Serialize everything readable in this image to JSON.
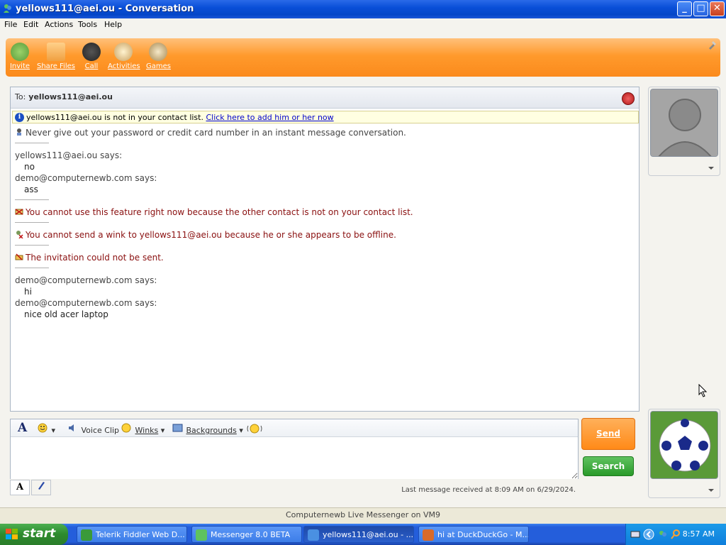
{
  "window": {
    "title": "yellows111@aei.ou - Conversation",
    "min_label": "_",
    "max_label": "□",
    "close_label": "✕"
  },
  "menu": [
    "File",
    "Edit",
    "Actions",
    "Tools",
    "Help"
  ],
  "toolbar": {
    "items": [
      {
        "label": "Invite",
        "icon": "invite-icon"
      },
      {
        "label": "Share Files",
        "icon": "folder-icon"
      },
      {
        "label": "Call",
        "icon": "phone-icon"
      },
      {
        "label": "Activities",
        "icon": "activities-icon"
      },
      {
        "label": "Games",
        "icon": "games-icon"
      }
    ]
  },
  "conversation": {
    "to_label": "To:",
    "to_address": "yellows111@aei.ou",
    "info_text": "yellows111@aei.ou is not in your contact list.",
    "info_link": "Click here to add him or her now",
    "messages": [
      {
        "type": "system",
        "text": "Never give out your password or credit card number in an instant message conversation."
      },
      {
        "type": "header",
        "text": "yellows111@aei.ou says:"
      },
      {
        "type": "body",
        "text": "no"
      },
      {
        "type": "header",
        "text": "demo@computernewb.com says:"
      },
      {
        "type": "body",
        "text": "ass"
      },
      {
        "type": "warn",
        "text": "You cannot use this feature right now because the other contact is not on your contact list."
      },
      {
        "type": "warn",
        "text": "You cannot send a wink to yellows111@aei.ou because he or she appears to be offline."
      },
      {
        "type": "warn",
        "text": "The invitation could not be sent."
      },
      {
        "type": "header",
        "text": "demo@computernewb.com says:"
      },
      {
        "type": "body",
        "text": "hi"
      },
      {
        "type": "header",
        "text": "demo@computernewb.com says:"
      },
      {
        "type": "body",
        "text": "nice old acer laptop"
      }
    ]
  },
  "compose": {
    "font_button": "A",
    "voice_clip": "Voice Clip",
    "winks": "Winks",
    "backgrounds": "Backgrounds",
    "send": "Send",
    "search": "Search",
    "last_message": "Last message received at 8:09 AM on 6/29/2024."
  },
  "status_bar": "Computernewb Live Messenger on VM9",
  "taskbar": {
    "start": "start",
    "tasks": [
      {
        "label": "Telerik Fiddler Web D...",
        "active": false
      },
      {
        "label": "Messenger 8.0 BETA",
        "active": false
      },
      {
        "label": "yellows111@aei.ou - ...",
        "active": true
      },
      {
        "label": "hi at DuckDuckGo - M...",
        "active": false
      }
    ],
    "clock": "8:57 AM"
  },
  "colors": {
    "toolbar_orange": "#ff9a2c",
    "warn_red": "#8a1010",
    "send_orange": "#ff8a18",
    "search_green": "#2a9a2a",
    "taskbar_blue": "#245edb"
  }
}
